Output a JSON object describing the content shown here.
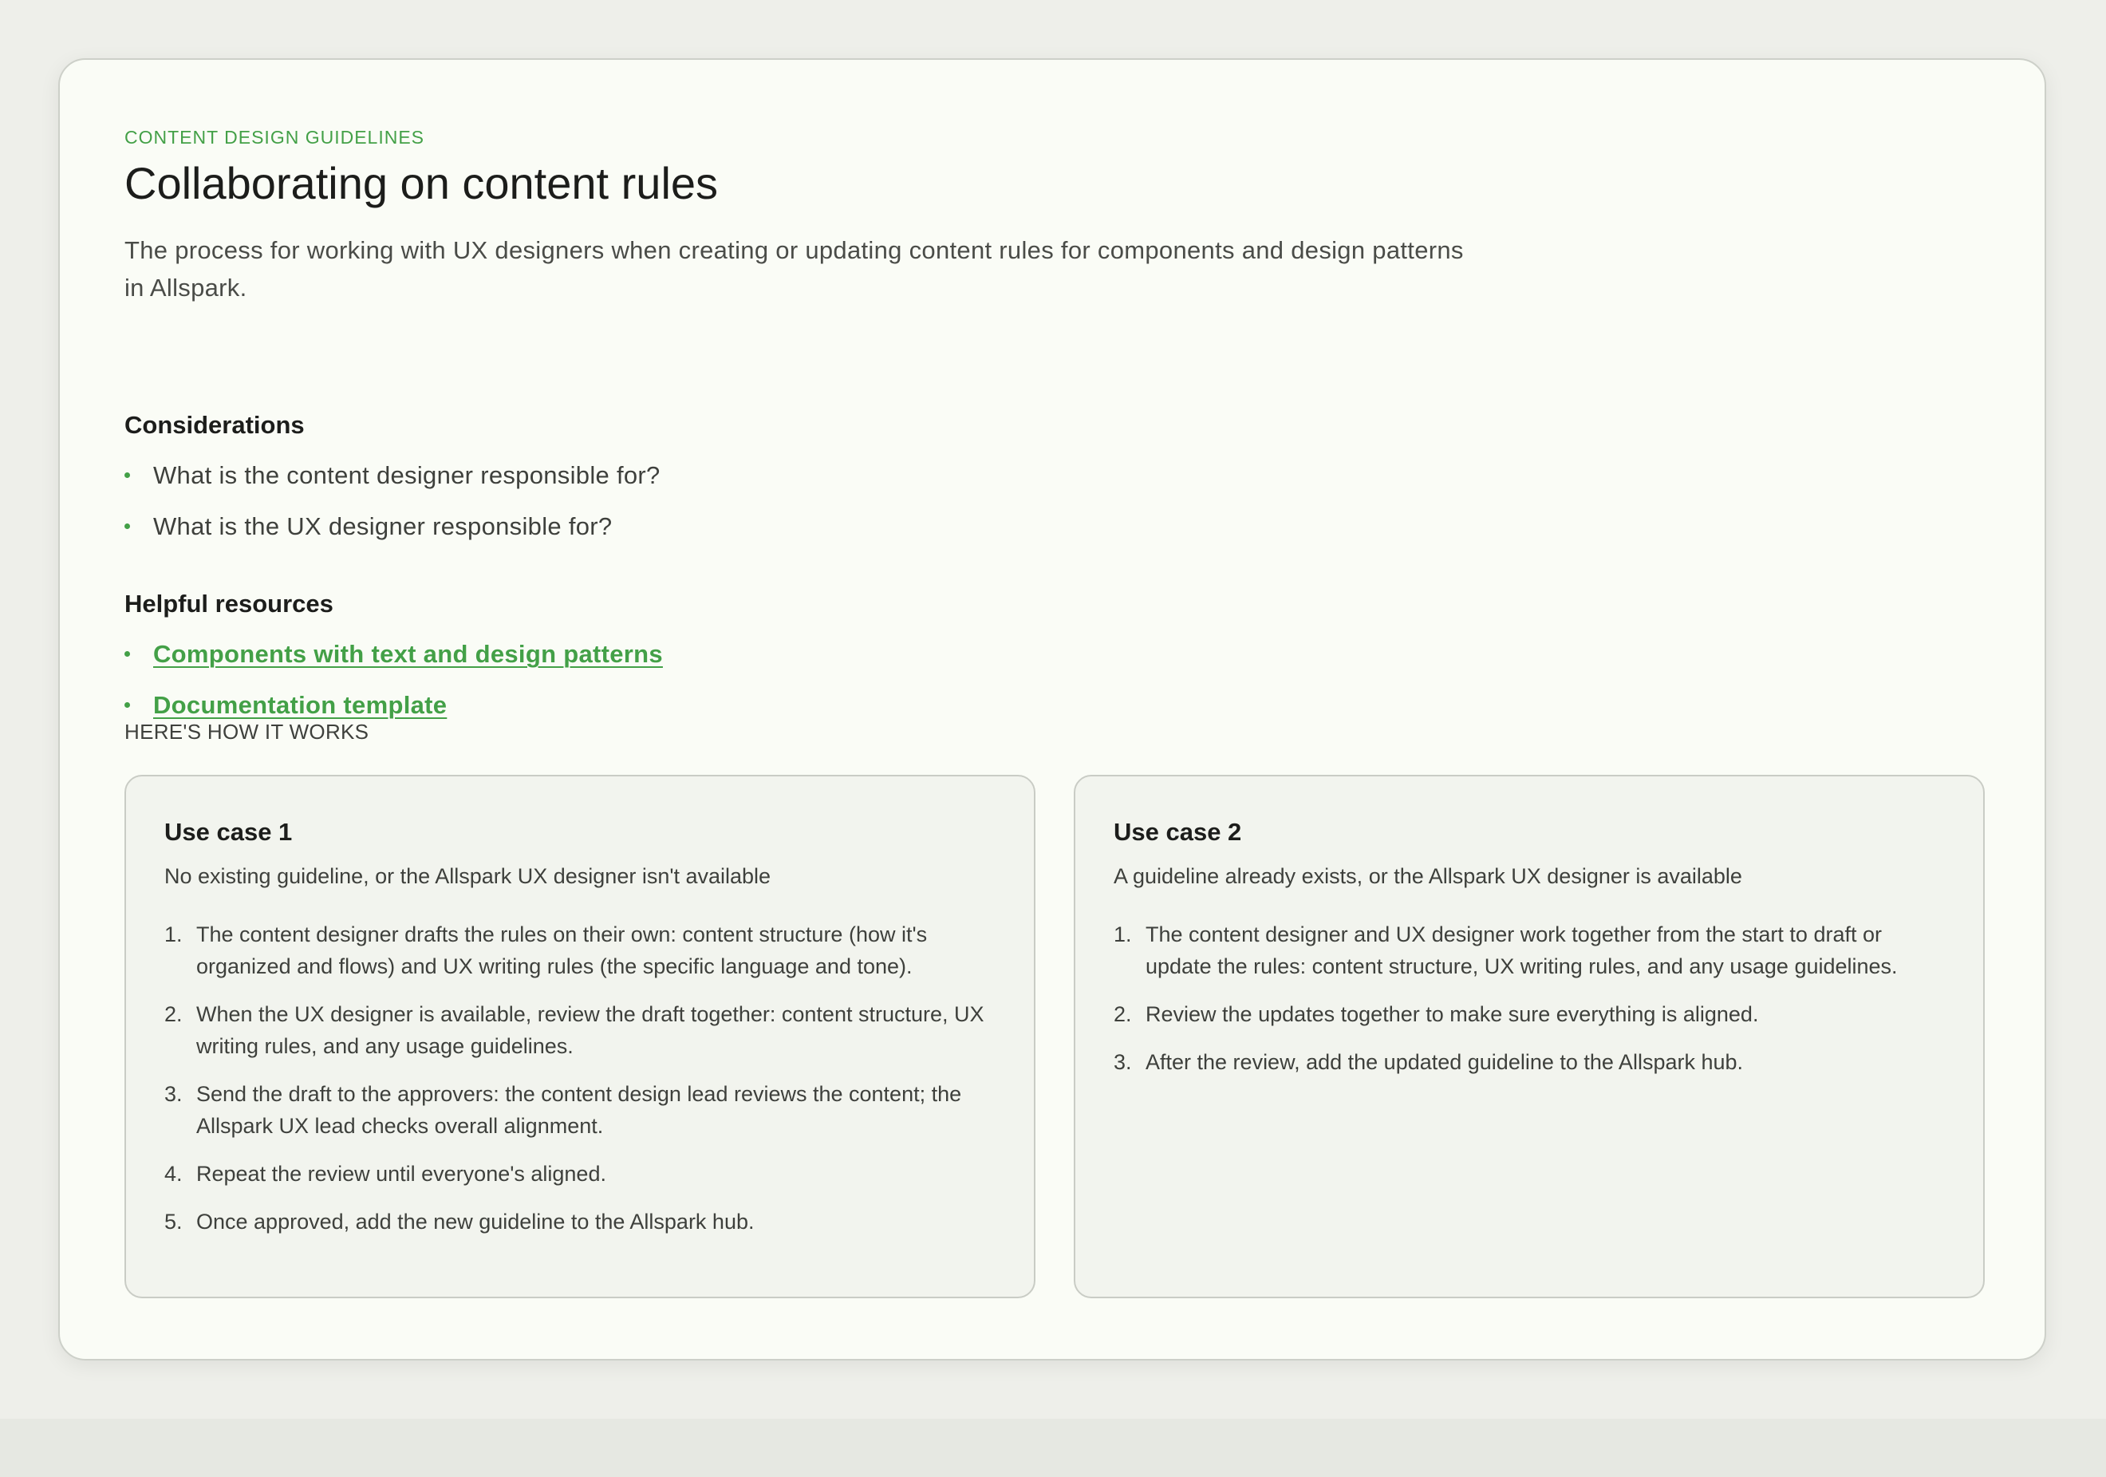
{
  "header": {
    "eyebrow": "CONTENT DESIGN GUIDELINES",
    "title": "Collaborating on content rules",
    "description": "The process for working with UX designers when creating or updating content rules for components and design patterns in Allspark."
  },
  "considerations": {
    "title": "Considerations",
    "items": [
      "What is the content designer responsible for?",
      "What is the UX designer responsible for?"
    ]
  },
  "resources": {
    "title": "Helpful resources",
    "links": [
      "Components with text and design patterns",
      "Documentation template"
    ]
  },
  "how_it_works": {
    "label": "HERE'S HOW IT WORKS",
    "use_cases": [
      {
        "title": "Use case 1",
        "subtitle": "No existing guideline, or the Allspark UX designer isn't available",
        "steps": [
          "The content designer drafts the rules on their own: content structure (how it's organized and flows) and UX writing rules (the specific language and tone).",
          "When the UX designer is available, review the draft together: content structure, UX writing rules, and any usage guidelines.",
          "Send the draft to the approvers: the content design lead reviews the content; the Allspark UX lead checks overall alignment.",
          "Repeat the review until everyone's aligned.",
          "Once approved, add the new guideline to the Allspark hub."
        ]
      },
      {
        "title": "Use case 2",
        "subtitle": "A guideline already exists, or the Allspark UX designer is available",
        "steps": [
          "The content designer and UX designer work together from the start to draft or update the rules: content structure, UX writing rules, and any usage guidelines.",
          "Review the updates together to make sure everything is aligned.",
          "After the review, add the updated guideline to the Allspark hub."
        ]
      }
    ]
  },
  "colors": {
    "accent": "#43a047",
    "page_background": "#eeefea",
    "card_background": "#fafcf6",
    "panel_background": "#f2f4ee"
  }
}
